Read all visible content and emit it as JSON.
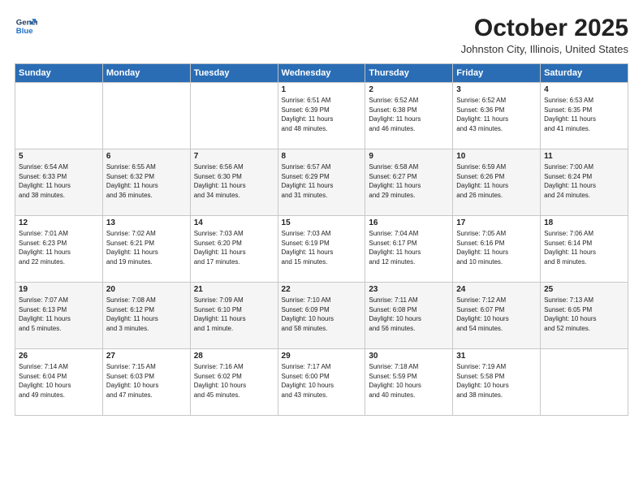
{
  "logo": {
    "line1": "General",
    "line2": "Blue"
  },
  "title": "October 2025",
  "location": "Johnston City, Illinois, United States",
  "header_days": [
    "Sunday",
    "Monday",
    "Tuesday",
    "Wednesday",
    "Thursday",
    "Friday",
    "Saturday"
  ],
  "weeks": [
    [
      {
        "day": "",
        "info": ""
      },
      {
        "day": "",
        "info": ""
      },
      {
        "day": "",
        "info": ""
      },
      {
        "day": "1",
        "info": "Sunrise: 6:51 AM\nSunset: 6:39 PM\nDaylight: 11 hours\nand 48 minutes."
      },
      {
        "day": "2",
        "info": "Sunrise: 6:52 AM\nSunset: 6:38 PM\nDaylight: 11 hours\nand 46 minutes."
      },
      {
        "day": "3",
        "info": "Sunrise: 6:52 AM\nSunset: 6:36 PM\nDaylight: 11 hours\nand 43 minutes."
      },
      {
        "day": "4",
        "info": "Sunrise: 6:53 AM\nSunset: 6:35 PM\nDaylight: 11 hours\nand 41 minutes."
      }
    ],
    [
      {
        "day": "5",
        "info": "Sunrise: 6:54 AM\nSunset: 6:33 PM\nDaylight: 11 hours\nand 38 minutes."
      },
      {
        "day": "6",
        "info": "Sunrise: 6:55 AM\nSunset: 6:32 PM\nDaylight: 11 hours\nand 36 minutes."
      },
      {
        "day": "7",
        "info": "Sunrise: 6:56 AM\nSunset: 6:30 PM\nDaylight: 11 hours\nand 34 minutes."
      },
      {
        "day": "8",
        "info": "Sunrise: 6:57 AM\nSunset: 6:29 PM\nDaylight: 11 hours\nand 31 minutes."
      },
      {
        "day": "9",
        "info": "Sunrise: 6:58 AM\nSunset: 6:27 PM\nDaylight: 11 hours\nand 29 minutes."
      },
      {
        "day": "10",
        "info": "Sunrise: 6:59 AM\nSunset: 6:26 PM\nDaylight: 11 hours\nand 26 minutes."
      },
      {
        "day": "11",
        "info": "Sunrise: 7:00 AM\nSunset: 6:24 PM\nDaylight: 11 hours\nand 24 minutes."
      }
    ],
    [
      {
        "day": "12",
        "info": "Sunrise: 7:01 AM\nSunset: 6:23 PM\nDaylight: 11 hours\nand 22 minutes."
      },
      {
        "day": "13",
        "info": "Sunrise: 7:02 AM\nSunset: 6:21 PM\nDaylight: 11 hours\nand 19 minutes."
      },
      {
        "day": "14",
        "info": "Sunrise: 7:03 AM\nSunset: 6:20 PM\nDaylight: 11 hours\nand 17 minutes."
      },
      {
        "day": "15",
        "info": "Sunrise: 7:03 AM\nSunset: 6:19 PM\nDaylight: 11 hours\nand 15 minutes."
      },
      {
        "day": "16",
        "info": "Sunrise: 7:04 AM\nSunset: 6:17 PM\nDaylight: 11 hours\nand 12 minutes."
      },
      {
        "day": "17",
        "info": "Sunrise: 7:05 AM\nSunset: 6:16 PM\nDaylight: 11 hours\nand 10 minutes."
      },
      {
        "day": "18",
        "info": "Sunrise: 7:06 AM\nSunset: 6:14 PM\nDaylight: 11 hours\nand 8 minutes."
      }
    ],
    [
      {
        "day": "19",
        "info": "Sunrise: 7:07 AM\nSunset: 6:13 PM\nDaylight: 11 hours\nand 5 minutes."
      },
      {
        "day": "20",
        "info": "Sunrise: 7:08 AM\nSunset: 6:12 PM\nDaylight: 11 hours\nand 3 minutes."
      },
      {
        "day": "21",
        "info": "Sunrise: 7:09 AM\nSunset: 6:10 PM\nDaylight: 11 hours\nand 1 minute."
      },
      {
        "day": "22",
        "info": "Sunrise: 7:10 AM\nSunset: 6:09 PM\nDaylight: 10 hours\nand 58 minutes."
      },
      {
        "day": "23",
        "info": "Sunrise: 7:11 AM\nSunset: 6:08 PM\nDaylight: 10 hours\nand 56 minutes."
      },
      {
        "day": "24",
        "info": "Sunrise: 7:12 AM\nSunset: 6:07 PM\nDaylight: 10 hours\nand 54 minutes."
      },
      {
        "day": "25",
        "info": "Sunrise: 7:13 AM\nSunset: 6:05 PM\nDaylight: 10 hours\nand 52 minutes."
      }
    ],
    [
      {
        "day": "26",
        "info": "Sunrise: 7:14 AM\nSunset: 6:04 PM\nDaylight: 10 hours\nand 49 minutes."
      },
      {
        "day": "27",
        "info": "Sunrise: 7:15 AM\nSunset: 6:03 PM\nDaylight: 10 hours\nand 47 minutes."
      },
      {
        "day": "28",
        "info": "Sunrise: 7:16 AM\nSunset: 6:02 PM\nDaylight: 10 hours\nand 45 minutes."
      },
      {
        "day": "29",
        "info": "Sunrise: 7:17 AM\nSunset: 6:00 PM\nDaylight: 10 hours\nand 43 minutes."
      },
      {
        "day": "30",
        "info": "Sunrise: 7:18 AM\nSunset: 5:59 PM\nDaylight: 10 hours\nand 40 minutes."
      },
      {
        "day": "31",
        "info": "Sunrise: 7:19 AM\nSunset: 5:58 PM\nDaylight: 10 hours\nand 38 minutes."
      },
      {
        "day": "",
        "info": ""
      }
    ]
  ]
}
